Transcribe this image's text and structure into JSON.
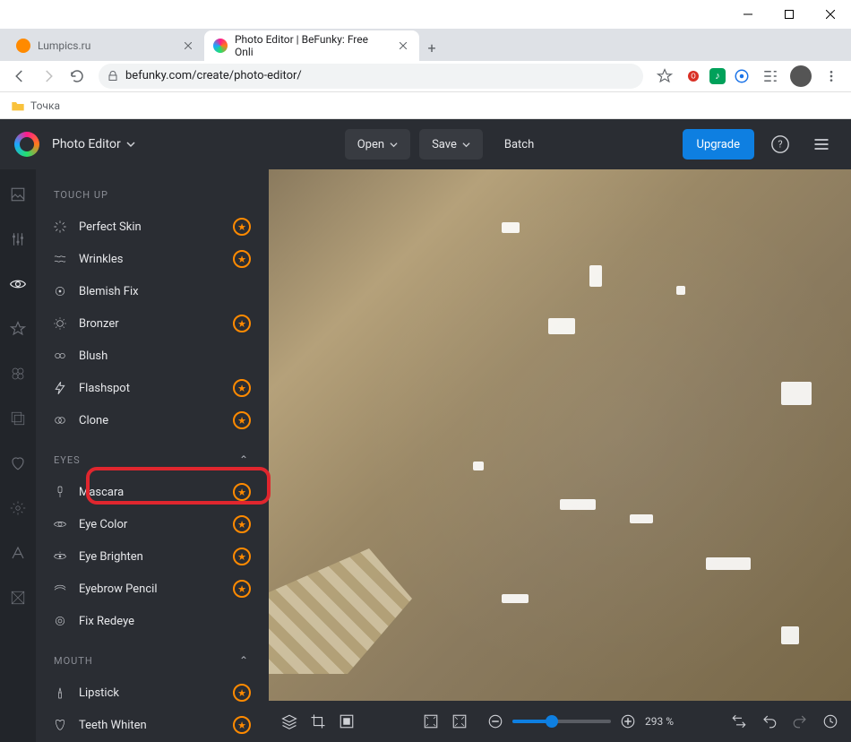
{
  "browser": {
    "tabs": [
      {
        "title": "Lumpics.ru"
      },
      {
        "title": "Photo Editor | BeFunky: Free Onli"
      }
    ],
    "url": "befunky.com/create/photo-editor/",
    "bookmark": "Точка"
  },
  "topbar": {
    "brand": "Photo Editor",
    "open": "Open",
    "save": "Save",
    "batch": "Batch",
    "upgrade": "Upgrade"
  },
  "sidebar": {
    "main_title": "TOUCH UP",
    "skin": [
      {
        "label": "Perfect Skin",
        "star": true
      },
      {
        "label": "Wrinkles",
        "star": true
      },
      {
        "label": "Blemish Fix",
        "star": false
      },
      {
        "label": "Bronzer",
        "star": true
      },
      {
        "label": "Blush",
        "star": false
      },
      {
        "label": "Flashspot",
        "star": true
      },
      {
        "label": "Clone",
        "star": true
      }
    ],
    "eyes_title": "EYES",
    "eyes": [
      {
        "label": "Mascara",
        "star": true
      },
      {
        "label": "Eye Color",
        "star": true
      },
      {
        "label": "Eye Brighten",
        "star": true
      },
      {
        "label": "Eyebrow Pencil",
        "star": true
      },
      {
        "label": "Fix Redeye",
        "star": false
      }
    ],
    "mouth_title": "MOUTH",
    "mouth": [
      {
        "label": "Lipstick",
        "star": true
      },
      {
        "label": "Teeth Whiten",
        "star": true
      }
    ]
  },
  "bottombar": {
    "zoom": "293 %"
  }
}
